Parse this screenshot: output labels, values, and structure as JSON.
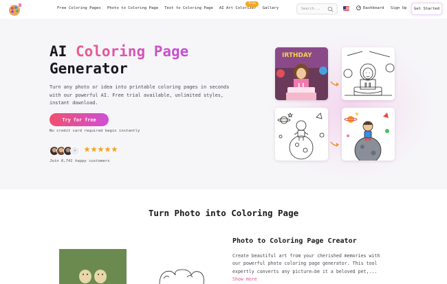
{
  "nav": {
    "links": [
      "Free Coloring Pages",
      "Photo to Coloring Page",
      "Text to Coloring Page",
      "AI Art Colorizer",
      "Gallery"
    ],
    "new_badge": "free",
    "search_placeholder": "Search...",
    "dashboard": "Dashboard",
    "signup": "Sign Up",
    "get_started": "Get Started"
  },
  "hero": {
    "title_plain": "AI ",
    "title_accent": "Coloring Page",
    "title_line2": "Generator",
    "description": "Turn any photo or idea into printable coloring pages in seconds with our powerful AI. Free trial available, unlimited styles, instant download.",
    "cta": "Try for free",
    "cta_note": "No credit card required begin instantly",
    "avatar_more": "+",
    "rating_stars": 5,
    "customers_text": "Join 6,741 happy customers"
  },
  "colors": {
    "accent_start": "#f0506e",
    "accent_end": "#d04fd6",
    "star": "#f5a623",
    "arrow": "#f5922b"
  },
  "section": {
    "title": "Turn Photo into Coloring Page",
    "creator_title": "Photo to Coloring Page Creator",
    "creator_text": "Create beautiful art from your cherished memories with our powerful photo coloring page generator. This tool expertly converts any picture—be it a beloved pet,...",
    "show_more": "Show more"
  }
}
